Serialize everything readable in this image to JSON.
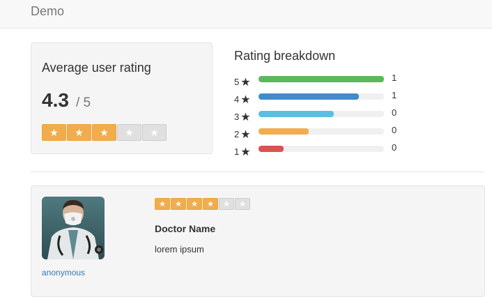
{
  "navbar": {
    "brand": "Demo"
  },
  "average": {
    "title": "Average user rating",
    "score": "4.3",
    "max": "/ 5",
    "stars_filled": 3,
    "stars_total": 5
  },
  "breakdown": {
    "title": "Rating breakdown",
    "rows": [
      {
        "stars": "5",
        "fill_fraction": 1.0,
        "count": "1",
        "color": "#5cb85c"
      },
      {
        "stars": "4",
        "fill_fraction": 0.8,
        "count": "1",
        "color": "#428bca"
      },
      {
        "stars": "3",
        "fill_fraction": 0.6,
        "count": "0",
        "color": "#5bc0de"
      },
      {
        "stars": "2",
        "fill_fraction": 0.4,
        "count": "0",
        "color": "#f0ad4e"
      },
      {
        "stars": "1",
        "fill_fraction": 0.2,
        "count": "0",
        "color": "#d9534f"
      }
    ]
  },
  "review": {
    "author": "anonymous",
    "stars_filled": 4,
    "stars_total": 6,
    "title": "Doctor Name",
    "text": "lorem ipsum"
  },
  "icons": {
    "star": "★"
  },
  "colors": {
    "star_on": "#f0ad4e",
    "star_off": "#e0e0e0",
    "link": "#337ab7"
  }
}
